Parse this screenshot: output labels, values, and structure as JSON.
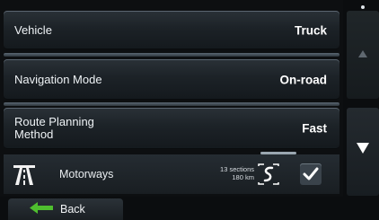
{
  "settings": {
    "vehicle": {
      "label": "Vehicle",
      "value": "Truck"
    },
    "navigation_mode": {
      "label": "Navigation Mode",
      "value": "On-road"
    },
    "route_planning": {
      "label_line1": "Route Planning",
      "label_line2": "Method",
      "value": "Fast"
    }
  },
  "motorways": {
    "label": "Motorways",
    "sections": "13 sections",
    "distance": "180 km",
    "enabled": true,
    "icon": "motorway-icon",
    "route_icon": "route-preview-icon"
  },
  "back": {
    "label": "Back",
    "icon": "back-arrow-icon"
  },
  "scroll": {
    "up_icon": "scroll-up-icon",
    "down_icon": "scroll-down-icon"
  },
  "colors": {
    "accent_arrow": "#4fbf2f",
    "row_bg": "#1c2227",
    "text": "#ffffff"
  }
}
